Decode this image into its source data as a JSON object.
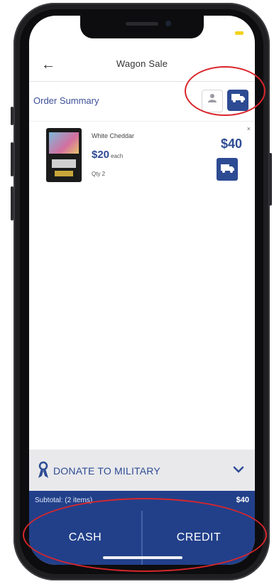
{
  "header": {
    "title": "Wagon Sale"
  },
  "order": {
    "section_label": "Order Summary",
    "fulfillment": {
      "pickup_icon": "person-icon",
      "ship_icon": "truck-icon"
    }
  },
  "item": {
    "name": "White Cheddar",
    "unit_price": "$20",
    "each_label": "each",
    "qty": "Qty 2",
    "line_total": "$40",
    "remove_icon": "×"
  },
  "donate": {
    "label": "DONATE TO MILITARY",
    "icon": "ribbon-icon"
  },
  "subtotal": {
    "label": "Subtotal: (2 items)",
    "amount": "$40"
  },
  "payment": {
    "cash_label": "CASH",
    "credit_label": "CREDIT"
  },
  "colors": {
    "brand_blue": "#22408a",
    "accent_yellow": "#f2d21b",
    "annotation_red": "#d9262b"
  }
}
